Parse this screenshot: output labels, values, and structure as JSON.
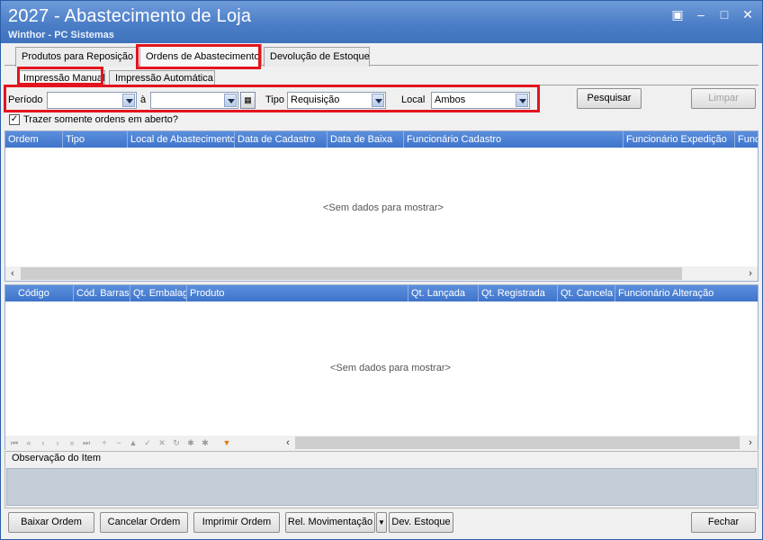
{
  "window": {
    "title": "2027 - Abastecimento de Loja",
    "subtitle": "Winthor - PC Sistemas",
    "controls": [
      "▣",
      "–",
      "□",
      "✕"
    ]
  },
  "tabs": [
    {
      "label": "Produtos para Reposição"
    },
    {
      "label": "Ordens de Abastecimento"
    },
    {
      "label": "Devolução de Estoque"
    }
  ],
  "subtabs": [
    {
      "label": "Impressão Manual"
    },
    {
      "label": "Impressão Automática"
    }
  ],
  "filters": {
    "periodo_label": "Período",
    "periodo_from_value": "",
    "a_label": "à",
    "periodo_to_value": "",
    "tipo_label": "Tipo",
    "tipo_value": "Requisição",
    "local_label": "Local",
    "local_value": "Ambos",
    "pesquisar_label": "Pesquisar",
    "limpar_label": "Limpar",
    "checkbox_label": "Trazer somente ordens em aberto?",
    "checkbox_checked": true
  },
  "orders_grid": {
    "columns": [
      "Ordem",
      "Tipo",
      "Local de Abastecimento",
      "Data de Cadastro",
      "Data de Baixa",
      "Funcionário Cadastro",
      "Funcionário Expedição",
      "Func"
    ],
    "empty_message": "<Sem dados para mostrar>"
  },
  "items_grid": {
    "columns": [
      "Código",
      "Cód. Barras",
      "Qt. Embalag",
      "Produto",
      "Qt. Lançada",
      "Qt. Registrada",
      "Qt. Cancela",
      "Funcionário Alteração"
    ],
    "empty_message": "<Sem dados para mostrar>",
    "nav_buttons": [
      "⏮",
      "«",
      "‹",
      "›",
      "»",
      "⏭",
      "+",
      "−",
      "▲",
      "✓",
      "✕",
      "↻",
      "✱",
      "✱",
      "▼"
    ]
  },
  "observation": {
    "label": "Observação do Item"
  },
  "footer": {
    "baixar": "Baixar Ordem",
    "cancelar": "Cancelar Ordem",
    "imprimir": "Imprimir Ordem",
    "rel_mov": "Rel. Movimentação",
    "dev_estoque": "Dev. Estoque",
    "fechar": "Fechar"
  },
  "colors": {
    "title_bar": "#4b7ec7",
    "grid_header": "#4a80d2",
    "highlight": "#e3141e"
  }
}
